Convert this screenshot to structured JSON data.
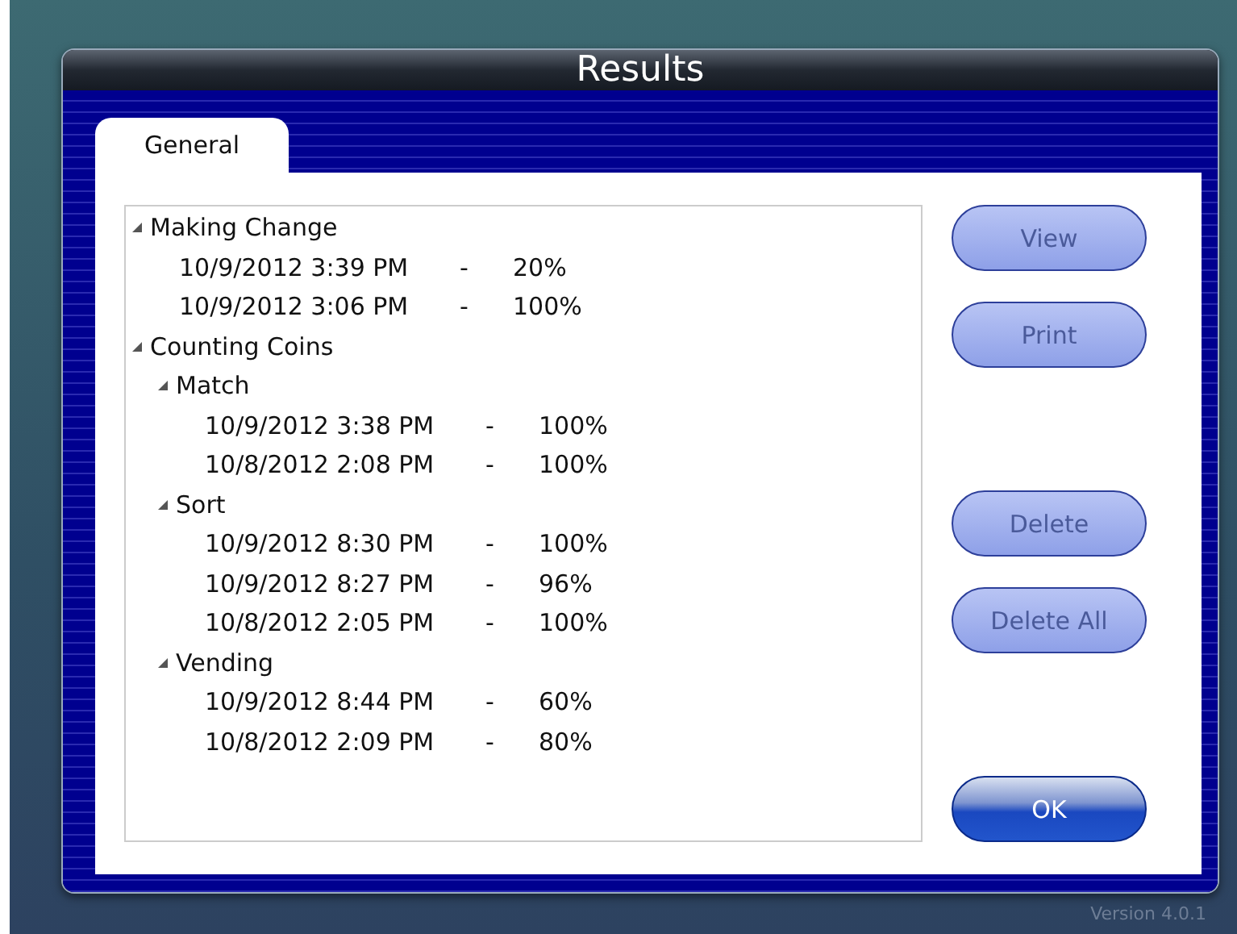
{
  "window": {
    "title": "Results"
  },
  "tabs": [
    {
      "label": "General",
      "selected": true
    }
  ],
  "tree": [
    {
      "kind": "group",
      "label": "Making Change",
      "expanded": true,
      "children": [
        {
          "kind": "entry",
          "date": "10/9/2012 3:39 PM",
          "separator": "-",
          "score": "20%"
        },
        {
          "kind": "entry",
          "date": "10/9/2012 3:06 PM",
          "separator": "-",
          "score": "100%"
        }
      ]
    },
    {
      "kind": "group",
      "label": "Counting Coins",
      "expanded": true,
      "children": [
        {
          "kind": "group",
          "label": "Match",
          "expanded": true,
          "children": [
            {
              "kind": "entry",
              "date": "10/9/2012 3:38 PM",
              "separator": "-",
              "score": "100%"
            },
            {
              "kind": "entry",
              "date": "10/8/2012 2:08 PM",
              "separator": "-",
              "score": "100%"
            }
          ]
        },
        {
          "kind": "group",
          "label": "Sort",
          "expanded": true,
          "children": [
            {
              "kind": "entry",
              "date": "10/9/2012 8:30 PM",
              "separator": "-",
              "score": "100%"
            },
            {
              "kind": "entry",
              "date": "10/9/2012 8:27 PM",
              "separator": "-",
              "score": "96%"
            },
            {
              "kind": "entry",
              "date": "10/8/2012 2:05 PM",
              "separator": "-",
              "score": "100%"
            }
          ]
        },
        {
          "kind": "group",
          "label": "Vending",
          "expanded": true,
          "children": [
            {
              "kind": "entry",
              "date": "10/9/2012 8:44 PM",
              "separator": "-",
              "score": "60%"
            },
            {
              "kind": "entry",
              "date": "10/8/2012 2:09 PM",
              "separator": "-",
              "score": "80%"
            }
          ]
        }
      ]
    }
  ],
  "buttons": [
    {
      "label": "View",
      "kind": "secondary"
    },
    {
      "label": "Print",
      "kind": "secondary"
    },
    {
      "label": "Delete",
      "kind": "secondary",
      "gap_before": true
    },
    {
      "label": "Delete All",
      "kind": "secondary"
    },
    {
      "label": "OK",
      "kind": "primary",
      "gap_before": true
    }
  ],
  "version": "Version 4.0.1"
}
